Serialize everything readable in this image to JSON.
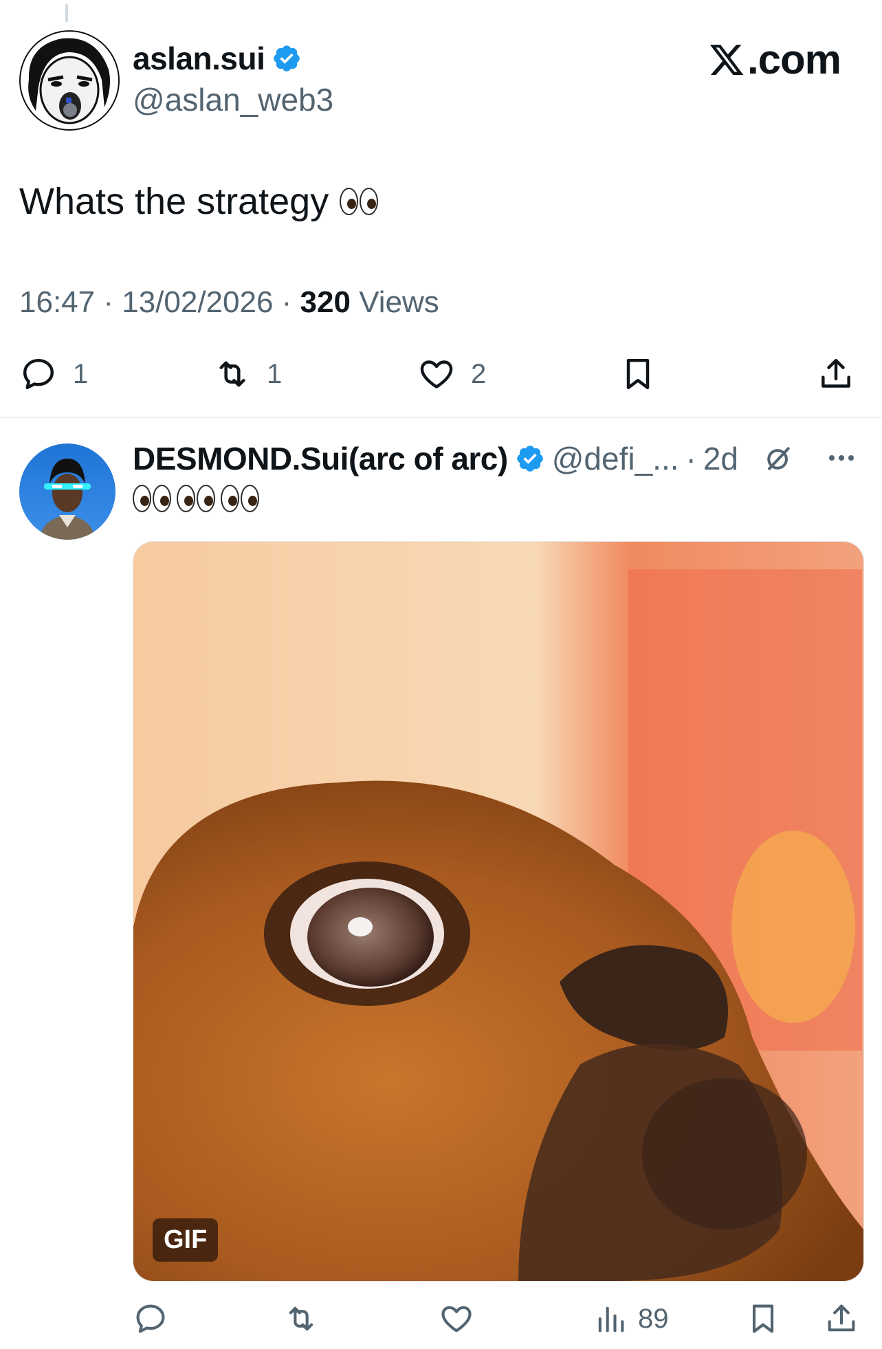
{
  "main_tweet": {
    "display_name": "aslan.sui",
    "handle": "@aslan_web3",
    "text": "Whats the strategy",
    "time": "16:47",
    "date": "13/02/2026",
    "views_count": "320",
    "views_label": "Views",
    "stats": {
      "replies": "1",
      "reposts": "1",
      "likes": "2"
    }
  },
  "brand": {
    "label": ".com"
  },
  "reply": {
    "display_name": "DESMOND.Sui(arc of arc)",
    "handle": "@defi_...",
    "age": "2d",
    "media_badge": "GIF",
    "views": "89"
  },
  "colors": {
    "verified": "#1d9bf0",
    "text": "#0f1419",
    "muted": "#536471",
    "divider": "#eff3f4"
  }
}
